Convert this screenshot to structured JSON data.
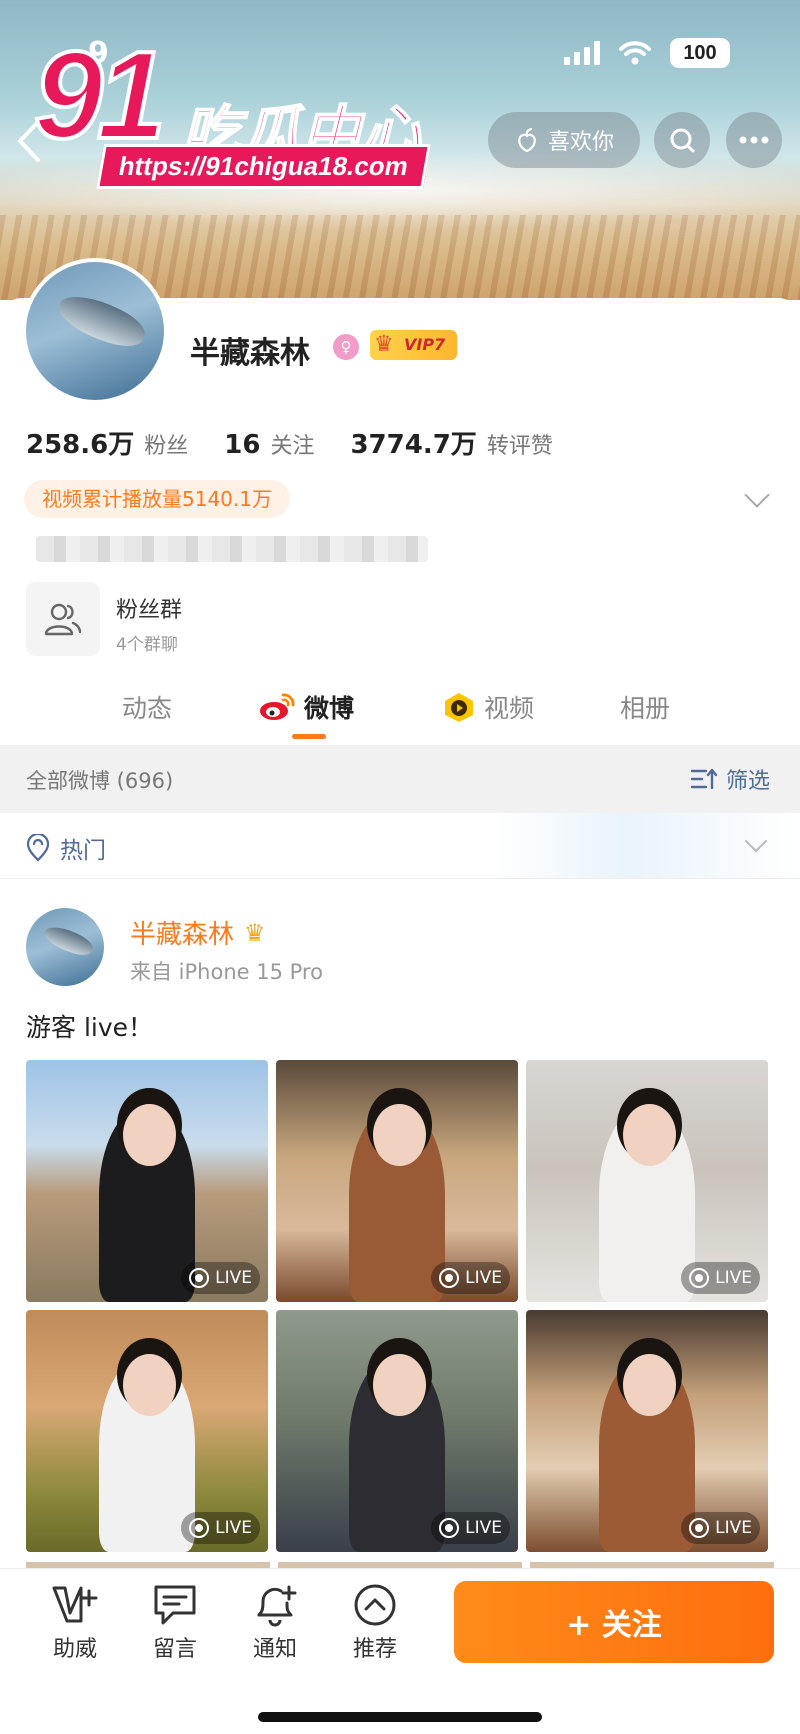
{
  "status_bar": {
    "time": "9",
    "battery": "100"
  },
  "watermark": {
    "number": "91",
    "text": "吃瓜中心",
    "url": "https://91chigua18.com"
  },
  "header": {
    "like_label": "喜欢你"
  },
  "profile": {
    "name": "半藏森林",
    "vip_label": "VIP7",
    "gender_icon": "female-icon",
    "stats": [
      {
        "value": "258.6万",
        "label": "粉丝"
      },
      {
        "value": "16",
        "label": "关注"
      },
      {
        "value": "3774.7万",
        "label": "转评赞"
      }
    ],
    "video_plays": "视频累计播放量5140.1万",
    "fan_group": {
      "title": "粉丝群",
      "subtitle": "4个群聊"
    }
  },
  "tabs": [
    {
      "label": "动态",
      "active": false
    },
    {
      "label": "微博",
      "active": true
    },
    {
      "label": "视频",
      "active": false
    },
    {
      "label": "相册",
      "active": false
    }
  ],
  "filter_bar": {
    "count_label": "全部微博 (696)",
    "filter_label": "筛选"
  },
  "hot_label": "热门",
  "post": {
    "author": "半藏森林",
    "source": "来自 iPhone 15 Pro",
    "text": "游客 live！",
    "live_label": "LIVE",
    "photo_count": 6
  },
  "bottom_bar": {
    "items": [
      {
        "label": "助威",
        "icon": "v-plus-icon"
      },
      {
        "label": "留言",
        "icon": "chat-bubble-icon"
      },
      {
        "label": "通知",
        "icon": "bell-plus-icon"
      },
      {
        "label": "推荐",
        "icon": "up-circle-icon"
      }
    ],
    "follow_label": "+ 关注"
  },
  "colors": {
    "accent": "#ff7a1a",
    "link": "#506b96",
    "watermark": "#e8195a"
  }
}
